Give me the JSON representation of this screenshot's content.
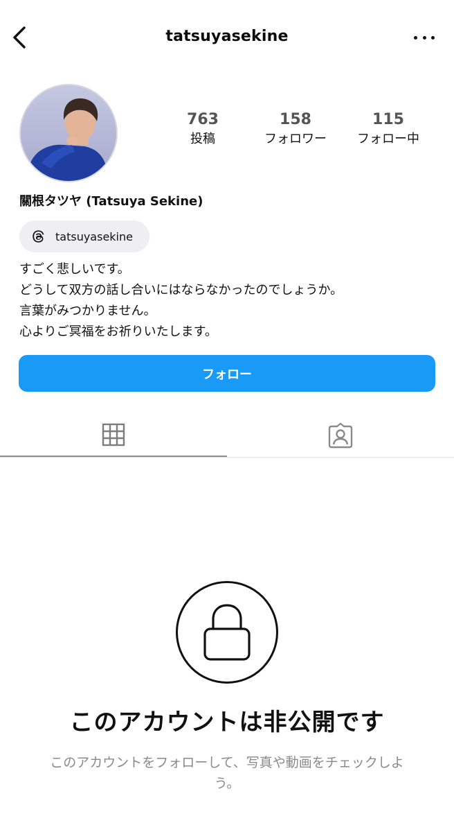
{
  "header": {
    "username": "tatsuyasekine",
    "back_icon": "chevron-left-icon",
    "more_icon": "more-horizontal-icon"
  },
  "profile": {
    "avatar_icon": "profile-photo",
    "display_name": "關根タツヤ (Tatsuya Sekine)",
    "threads_handle": "tatsuyasekine",
    "threads_icon": "threads-icon"
  },
  "stats": [
    {
      "count": "763",
      "label": "投稿"
    },
    {
      "count": "158",
      "label": "フォロワー"
    },
    {
      "count": "115",
      "label": "フォロー中"
    }
  ],
  "bio": [
    "すごく悲しいです。",
    "どうして双方の話し合いにはならなかったのでしょうか。",
    "言葉がみつかりません。",
    "心よりご冥福をお祈りいたします。"
  ],
  "actions": {
    "follow_label": "フォロー"
  },
  "tabs": {
    "grid_icon": "grid-icon",
    "tagged_icon": "tagged-person-icon",
    "active": "grid"
  },
  "private_notice": {
    "icon": "lock-icon",
    "title": "このアカウントは非公開です",
    "subtitle": "このアカウントをフォローして、写真や動画をチェックしよう。"
  },
  "colors": {
    "follow_button": "#1a9af7",
    "subtitle_text": "#8a8a8a",
    "chip_background": "#efeff1"
  }
}
